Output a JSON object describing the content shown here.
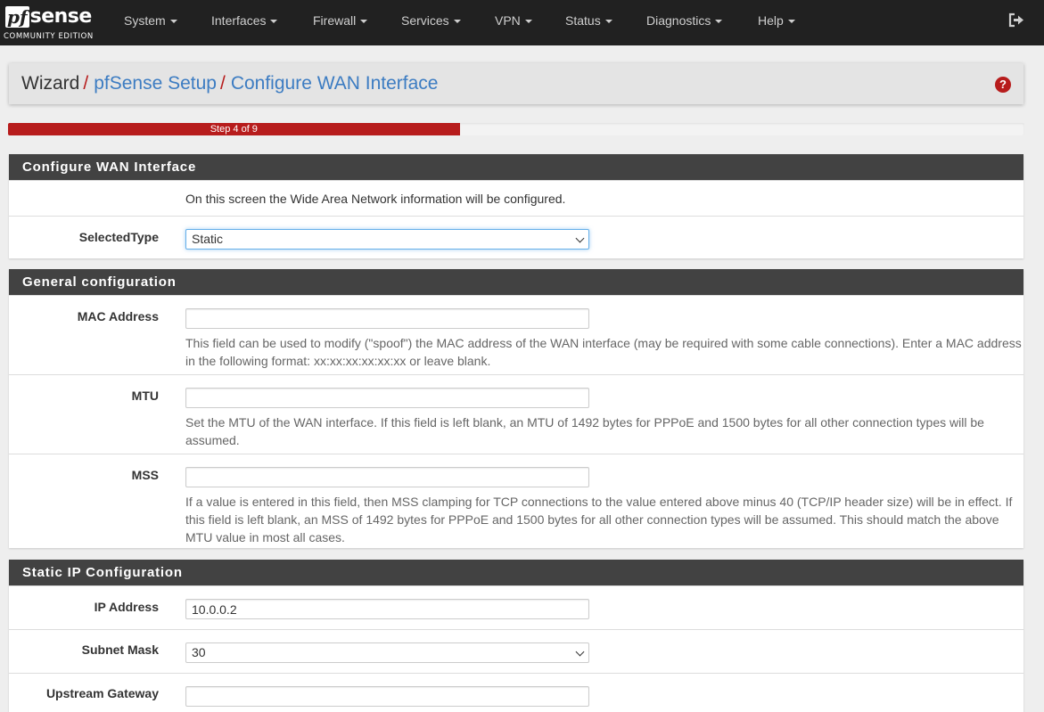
{
  "navbar": {
    "logo_pf": "pf",
    "logo_sense": "sense",
    "logo_edition": "COMMUNITY EDITION",
    "menu": [
      "System",
      "Interfaces",
      "Firewall",
      "Services",
      "VPN",
      "Status",
      "Diagnostics",
      "Help"
    ],
    "logout_icon": "sign-out-icon"
  },
  "breadcrumb": {
    "root": "Wizard",
    "separator": "/",
    "items": [
      "pfSense Setup",
      "Configure WAN Interface"
    ],
    "help_icon": "question-circle-icon"
  },
  "progress": {
    "label": "Step 4 of 9",
    "step": 4,
    "total": 9
  },
  "panels": {
    "wan": {
      "title": "Configure WAN Interface",
      "intro": "On this screen the Wide Area Network information will be configured.",
      "selected_type_label": "SelectedType",
      "selected_type_value": "Static"
    },
    "general": {
      "title": "General configuration",
      "mac_label": "MAC Address",
      "mac_value": "",
      "mac_help": "This field can be used to modify (\"spoof\") the MAC address of the WAN interface (may be required with some cable connections). Enter a MAC address in the following format: xx:xx:xx:xx:xx:xx or leave blank.",
      "mtu_label": "MTU",
      "mtu_value": "",
      "mtu_help": "Set the MTU of the WAN interface. If this field is left blank, an MTU of 1492 bytes for PPPoE and 1500 bytes for all other connection types will be assumed.",
      "mss_label": "MSS",
      "mss_value": "",
      "mss_help": "If a value is entered in this field, then MSS clamping for TCP connections to the value entered above minus 40 (TCP/IP header size) will be in effect. If this field is left blank, an MSS of 1492 bytes for PPPoE and 1500 bytes for all other connection types will be assumed. This should match the above MTU value in most all cases."
    },
    "static_ip": {
      "title": "Static IP Configuration",
      "ip_label": "IP Address",
      "ip_value": "10.0.0.2",
      "subnet_label": "Subnet Mask",
      "subnet_value": "30",
      "gateway_label": "Upstream Gateway",
      "gateway_value": ""
    }
  },
  "colors": {
    "navbar": "#212121",
    "accent_red": "#b71c1c",
    "link_blue": "#3c7cc2",
    "panel_heading": "#424242"
  }
}
